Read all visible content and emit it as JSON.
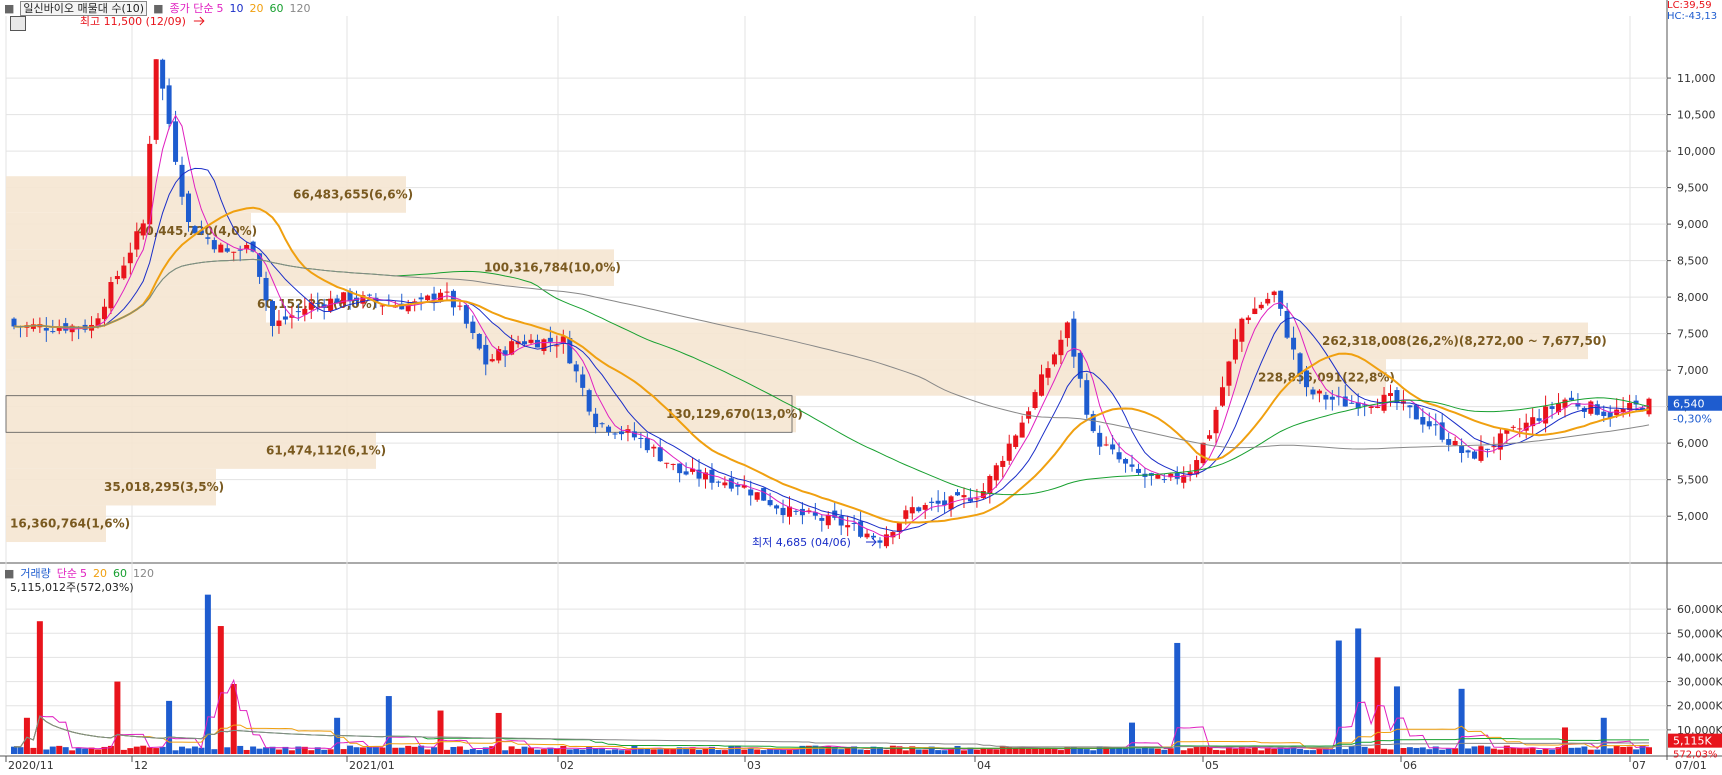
{
  "price_legend": {
    "title": "일신바이오 매물대 수(10)",
    "ma_label": "종가 단순",
    "ma_periods": [
      "5",
      "10",
      "20",
      "60",
      "120"
    ]
  },
  "volume_legend": {
    "title": "거래량",
    "ma_label": "단순",
    "ma_periods": [
      "5",
      "20",
      "60",
      "120"
    ],
    "current_volume": "5,115,012주(572,03%)"
  },
  "right_top": {
    "lc": "LC:39,59",
    "hc": "HC:-43,13"
  },
  "current_price": {
    "value": "6,540",
    "change": "-0,30%"
  },
  "current_volume_badge": {
    "value": "5,115K",
    "pct": "572,03%"
  },
  "annotations": {
    "high": "최고 11,500 (12/09)",
    "low": "최저 4,685 (04/06)"
  },
  "colors": {
    "up": "#e8141c",
    "down": "#1e5ccf",
    "ma5": "#e020c0",
    "ma10": "#1a2ec8",
    "ma20": "#f0a010",
    "ma60": "#18a030",
    "ma120": "#888888",
    "profile": "#f5e6d2"
  },
  "chart_data": [
    {
      "type": "candlestick",
      "title": "",
      "y_ticks": [
        "5,000",
        "5,500",
        "6,000",
        "6,500",
        "7,000",
        "7,500",
        "8,000",
        "8,500",
        "9,000",
        "9,500",
        "10,000",
        "10,500",
        "11,000"
      ],
      "ylim": [
        4400,
        11850
      ],
      "x_ticks": [
        "2020/11",
        "12",
        "2021/01",
        "02",
        "03",
        "04",
        "05",
        "06",
        "07"
      ],
      "right_label": "07/01",
      "volume_profile": [
        {
          "label": "16,360,764(1,6%)",
          "low": 4646,
          "high": 5147
        },
        {
          "label": "35,018,295(3,5%)",
          "low": 5147,
          "high": 5648
        },
        {
          "label": "61,474,112(6,1%)",
          "low": 5648,
          "high": 6149
        },
        {
          "label": "130,129,670(13,0%)",
          "low": 6149,
          "high": 6650
        },
        {
          "label": "228,856,091(22,8%)",
          "low": 6650,
          "high": 7151
        },
        {
          "label": "262,318,008(26,2%)(8,272,00 ~ 7,677,50)",
          "low": 7151,
          "high": 7652
        },
        {
          "label": "60,152,267(6,0%)",
          "low": 7652,
          "high": 8153
        },
        {
          "label": "100,316,784(10,0%)",
          "low": 8153,
          "high": 8654
        },
        {
          "label": "40,445,720(4,0%)",
          "low": 8654,
          "high": 9155
        },
        {
          "label": "66,483,655(6,6%)",
          "low": 9155,
          "high": 9656
        }
      ],
      "series": [
        {
          "name": "종가 단순 5"
        },
        {
          "name": "10"
        },
        {
          "name": "20"
        },
        {
          "name": "60"
        },
        {
          "name": "120"
        }
      ]
    },
    {
      "type": "bar",
      "title": "",
      "y_ticks": [
        "10,000K",
        "20,000K",
        "30,000K",
        "40,000K",
        "50,000K",
        "60,000K"
      ],
      "ylim": [
        0,
        70000
      ],
      "series": [
        {
          "name": "거래량"
        },
        {
          "name": "단순 5"
        },
        {
          "name": "20"
        },
        {
          "name": "60"
        },
        {
          "name": "120"
        }
      ]
    }
  ]
}
